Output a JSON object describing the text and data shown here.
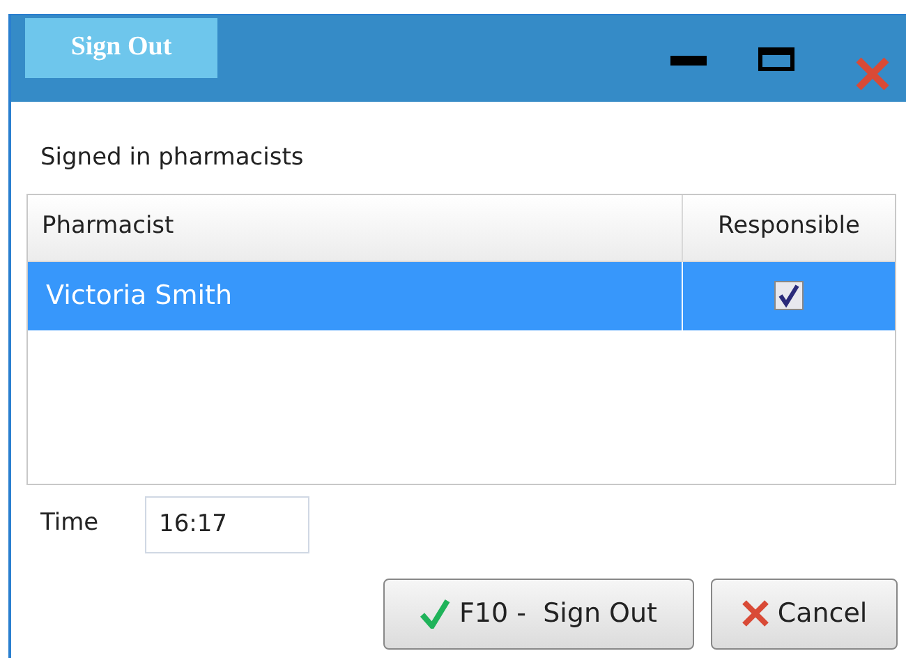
{
  "window": {
    "title": "Sign Out"
  },
  "section_label": "Signed in pharmacists",
  "table": {
    "columns": [
      "Pharmacist",
      "Responsible"
    ],
    "rows": [
      {
        "pharmacist": "Victoria Smith",
        "responsible": true,
        "selected": true
      }
    ]
  },
  "time": {
    "label": "Time",
    "value": "16:17"
  },
  "buttons": [
    {
      "kind": "confirm",
      "label": "F10 -  Sign Out"
    },
    {
      "kind": "cancel",
      "label": "Cancel"
    }
  ]
}
